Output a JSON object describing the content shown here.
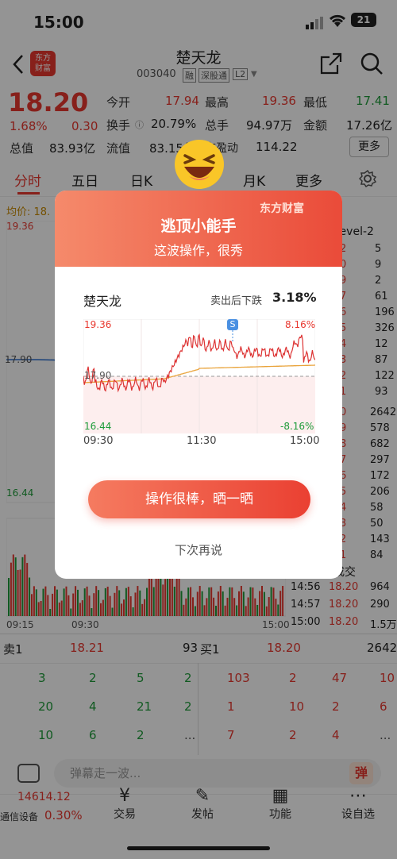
{
  "status": {
    "time": "15:00",
    "battery": "21"
  },
  "header": {
    "logo_text": "东方\n财富",
    "stock_name": "楚天龙",
    "stock_code": "003040",
    "tags": [
      "融",
      "深股通",
      "L2"
    ]
  },
  "quote": {
    "price": "18.20",
    "change_pct": "1.68%",
    "change": "0.30",
    "rows": [
      [
        {
          "label": "今开",
          "value": "17.94"
        },
        {
          "label": "最高",
          "value": "19.36"
        },
        {
          "label": "最低",
          "value": "17.41"
        }
      ],
      [
        {
          "label": "换手",
          "value": "20.79%"
        },
        {
          "label": "总手",
          "value": "94.97万"
        },
        {
          "label": "金额",
          "value": "17.26亿"
        }
      ],
      [
        {
          "label": "总值",
          "value": "83.93亿"
        },
        {
          "label": "流值",
          "value": "83.15亿"
        },
        {
          "label": "市盈动",
          "value": "114.22"
        }
      ]
    ],
    "more_label": "更多"
  },
  "tabs": [
    "分时",
    "五日",
    "日K",
    "周K",
    "月K",
    "更多"
  ],
  "chart": {
    "avg_label": "均价: 18.",
    "price_high": "19.36",
    "price_low": "16.44",
    "price_mid": "17.90",
    "time_start": "09:15",
    "time_mid": "09:30",
    "time_end": "15:00",
    "level2_label": "Level-2",
    "right_list_a": [
      "5",
      "9",
      "2",
      "61",
      "196",
      "326",
      "12",
      "87",
      "122",
      "93"
    ],
    "right_list_a_left": [
      "2",
      "0",
      "9",
      "7",
      "6",
      "5",
      "4",
      "3",
      "2",
      "1"
    ],
    "right_list_b": [
      "2642",
      "578",
      "682",
      "297",
      "172",
      "206",
      "58",
      "50",
      "143",
      "84"
    ],
    "right_list_b_left": [
      "0",
      "9",
      "8",
      "7",
      "6",
      "5",
      "4",
      "3",
      "2",
      "1"
    ],
    "trades_header": "成交",
    "trades": [
      {
        "time": "14:56",
        "price": "18.20",
        "vol": "964"
      },
      {
        "time": "14:57",
        "price": "18.20",
        "vol": "290"
      },
      {
        "time": "15:00",
        "price": "18.20",
        "vol": "1.5万"
      }
    ]
  },
  "book": {
    "sell1": {
      "label": "卖1",
      "price": "18.21",
      "vol": "93"
    },
    "buy1": {
      "label": "买1",
      "price": "18.20",
      "vol": "2642"
    },
    "left_rows": [
      [
        "3",
        "2",
        "5",
        "2"
      ],
      [
        "20",
        "4",
        "21",
        "2"
      ],
      [
        "10",
        "6",
        "2",
        "..."
      ]
    ],
    "right_rows": [
      [
        "103",
        "2",
        "47",
        "10"
      ],
      [
        "1",
        "10",
        "2",
        "6"
      ],
      [
        "7",
        "2",
        "4",
        "..."
      ]
    ]
  },
  "comment": {
    "placeholder": "弹幕走一波...",
    "dan_label": "弹"
  },
  "bottom": {
    "index_value": "14614.12",
    "index_name": "通信设备",
    "index_pct": "0.30%",
    "nav": [
      "交易",
      "发帖",
      "功能",
      "设自选"
    ]
  },
  "modal": {
    "title": "逃顶小能手",
    "subtitle": "这波操作，很秀",
    "brand": "东方财富",
    "stock_name": "楚天龙",
    "drop_label": "卖出后下跌",
    "drop_value": "3.18%",
    "y_high": "19.36",
    "y_low": "16.44",
    "y_mid": "17.90",
    "pct_high": "8.16%",
    "pct_low": "-8.16%",
    "t_start": "09:30",
    "t_mid": "11:30",
    "t_end": "15:00",
    "sell_marker": "S",
    "share_button": "操作很棒，晒一晒",
    "later_link": "下次再说"
  }
}
